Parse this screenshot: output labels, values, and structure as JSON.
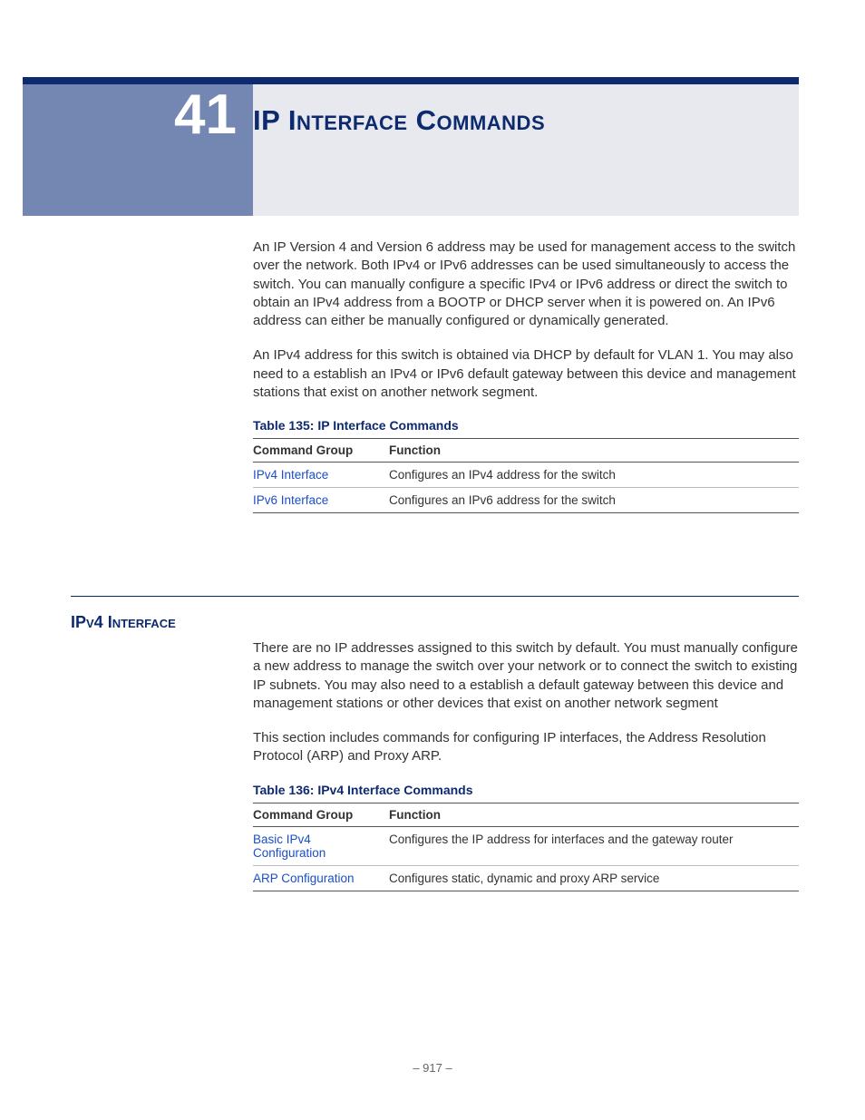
{
  "chapter": {
    "number": "41",
    "title": "IP Interface Commands"
  },
  "intro": {
    "p1": "An IP Version 4 and Version 6 address may be used for management access to the switch over the network. Both IPv4 or IPv6 addresses can be used simultaneously to access the switch. You can manually configure a specific IPv4 or IPv6 address or direct the switch to obtain an IPv4 address from a BOOTP or DHCP server when it is powered on. An IPv6 address can either be manually configured or dynamically generated.",
    "p2": "An IPv4 address for this switch is obtained via DHCP by default for VLAN 1. You may also need to a establish an IPv4 or IPv6 default gateway between this device and management stations that exist on another network segment."
  },
  "table135": {
    "title": "Table 135: IP Interface Commands",
    "headers": {
      "group": "Command Group",
      "function": "Function"
    },
    "rows": [
      {
        "group": "IPv4 Interface",
        "function": "Configures an IPv4 address for the switch"
      },
      {
        "group": "IPv6 Interface",
        "function": "Configures an IPv6 address for the switch"
      }
    ]
  },
  "section_ipv4": {
    "heading": "IPv4 Interface",
    "p1": "There are no IP addresses assigned to this switch by default. You must manually configure a new address to manage the switch over your network or to connect the switch to existing IP subnets. You may also need to a establish a default gateway between this device and management stations or other devices that exist on another network segment",
    "p2": "This section includes commands for configuring IP interfaces, the Address Resolution Protocol (ARP) and Proxy ARP."
  },
  "table136": {
    "title": "Table 136: IPv4 Interface Commands",
    "headers": {
      "group": "Command Group",
      "function": "Function"
    },
    "rows": [
      {
        "group": "Basic IPv4 Configuration",
        "function": "Configures the IP address for interfaces and the gateway router"
      },
      {
        "group": "ARP Configuration",
        "function": "Configures static, dynamic and proxy ARP service"
      }
    ]
  },
  "footer": {
    "page": "– 917 –"
  }
}
